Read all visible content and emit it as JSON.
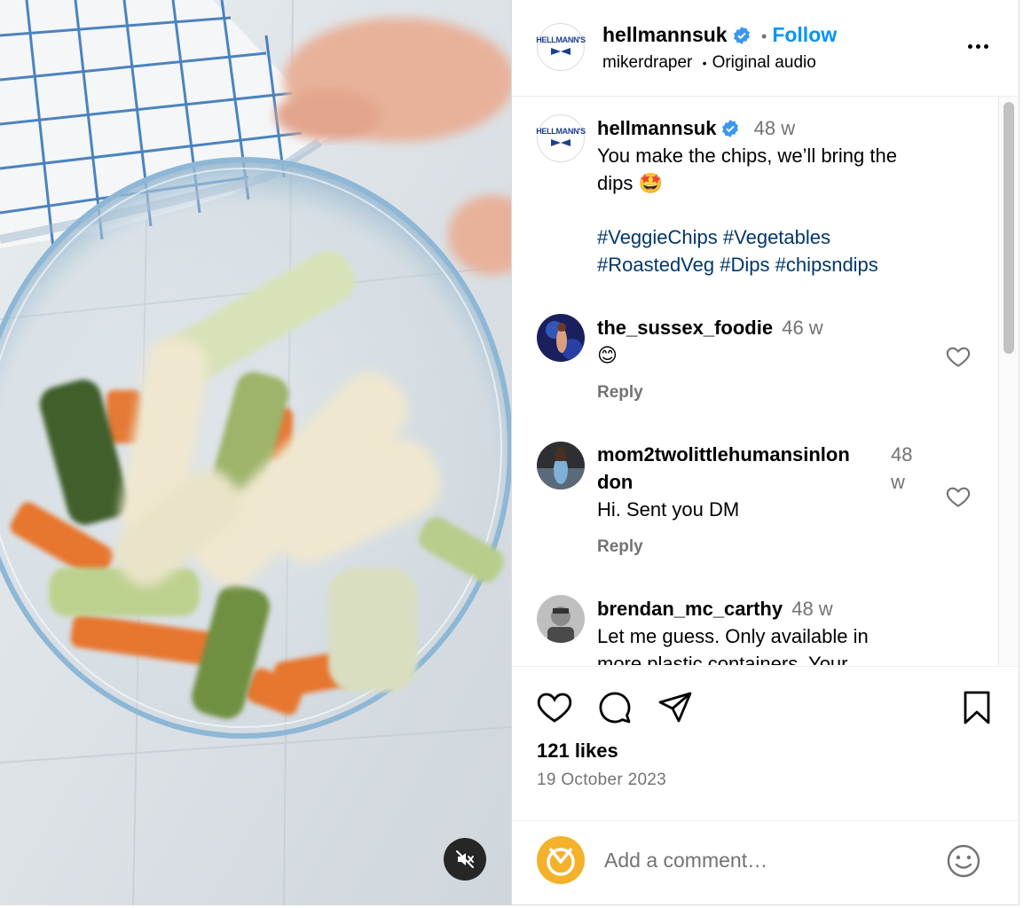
{
  "media": {
    "description_icon": "mute-icon"
  },
  "header": {
    "username": "hellmannsuk",
    "separator": "•",
    "follow_label": "Follow",
    "audio_author": "mikerdraper",
    "audio_dot": "•",
    "audio_label": "Original audio",
    "avatar_text": "HELLMANN'S"
  },
  "caption": {
    "username": "hellmannsuk",
    "age": "48 w",
    "line1": "You make the chips, we’ll bring the",
    "line2": "dips 🤩",
    "hashtags_line1": [
      "#VeggieChips",
      "#Vegetables"
    ],
    "hashtags_line2": [
      "#RoastedVeg",
      "#Dips",
      "#chipsndips"
    ]
  },
  "comments": [
    {
      "username": "the_sussex_foodie",
      "age": "46 w",
      "text": "😊",
      "reply_label": "Reply"
    },
    {
      "username_line1": "mom2twolittlehumansinlon",
      "username_line2": "don",
      "age_line1": "48",
      "age_line2": "w",
      "text": "Hi. Sent you DM",
      "reply_label": "Reply"
    },
    {
      "username": "brendan_mc_carthy",
      "age": "48 w",
      "text_line1": "Let me guess. Only available in",
      "text_line2": "more plastic containers. Your"
    }
  ],
  "actions": {
    "likes": "121 likes",
    "date": "19 October 2023"
  },
  "composer": {
    "placeholder": "Add a comment…"
  },
  "colors": {
    "accent_blue": "#0095f6",
    "hashtag": "#00376b",
    "muted_text": "#737373",
    "verified_badge": "#3897f0",
    "user_avatar": "#f4b12a"
  }
}
